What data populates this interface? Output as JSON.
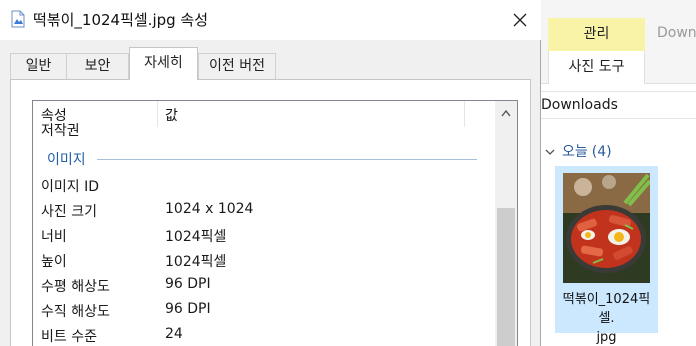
{
  "dialog": {
    "title": "떡볶이_1024픽셀.jpg 속성",
    "tabs": [
      {
        "label": "일반",
        "active": false
      },
      {
        "label": "보안",
        "active": false
      },
      {
        "label": "자세히",
        "active": true
      },
      {
        "label": "이전 버전",
        "active": false
      }
    ],
    "details": {
      "columns": {
        "property": "속성",
        "value": "값"
      },
      "partial_row": "저작권",
      "group_image": "이미지",
      "rows": [
        {
          "key": "이미지 ID",
          "value": ""
        },
        {
          "key": "사진 크기",
          "value": "1024 x 1024"
        },
        {
          "key": "너비",
          "value": "1024픽셀"
        },
        {
          "key": "높이",
          "value": "1024픽셀"
        },
        {
          "key": "수평 해상도",
          "value": "96 DPI"
        },
        {
          "key": "수직 해상도",
          "value": "96 DPI"
        },
        {
          "key": "비트 수준",
          "value": "24"
        }
      ]
    }
  },
  "explorer": {
    "ribbon": {
      "context_group": "관리",
      "next_tab": "Down",
      "context_tab": "사진 도구"
    },
    "address": "Downloads",
    "group": {
      "label": "오늘",
      "count": "(4)"
    },
    "file": {
      "name_line1": "떡볶이_1024픽셀.",
      "name_line2": "jpg"
    }
  },
  "colors": {
    "group_header": "#1f5ea8",
    "selection": "#cce8ff",
    "context_ribbon": "#f9f3a8"
  }
}
